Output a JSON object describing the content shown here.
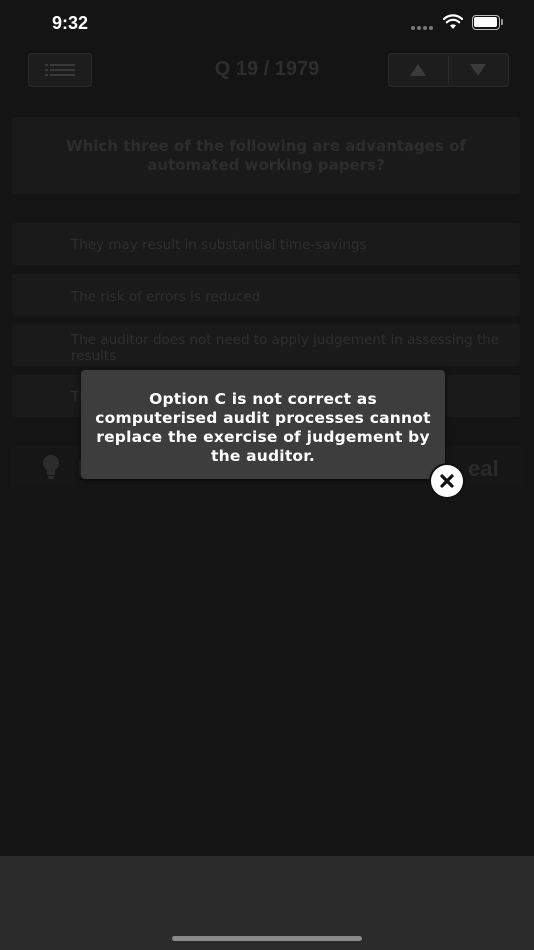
{
  "status_bar": {
    "time": "9:32"
  },
  "nav": {
    "menu_icon": "list-icon",
    "counter": "Q 19 / 1979",
    "up_icon": "triangle-up-icon",
    "down_icon": "triangle-down-icon"
  },
  "question": {
    "text": "Which three of the following are advantages of automated working papers?"
  },
  "options": [
    {
      "text": "They may result in substantial time-savings"
    },
    {
      "text": "The risk of errors is reduced"
    },
    {
      "text": "The auditor does not need to apply judgement in assessing the results"
    },
    {
      "text": "Th"
    }
  ],
  "bottom_row": {
    "hint_label": "I",
    "reveal_label": "eal"
  },
  "popup": {
    "message": "Option C is not correct as computerised audit processes cannot replace the exercise of judgement by the auditor.",
    "close_icon": "close-icon"
  }
}
